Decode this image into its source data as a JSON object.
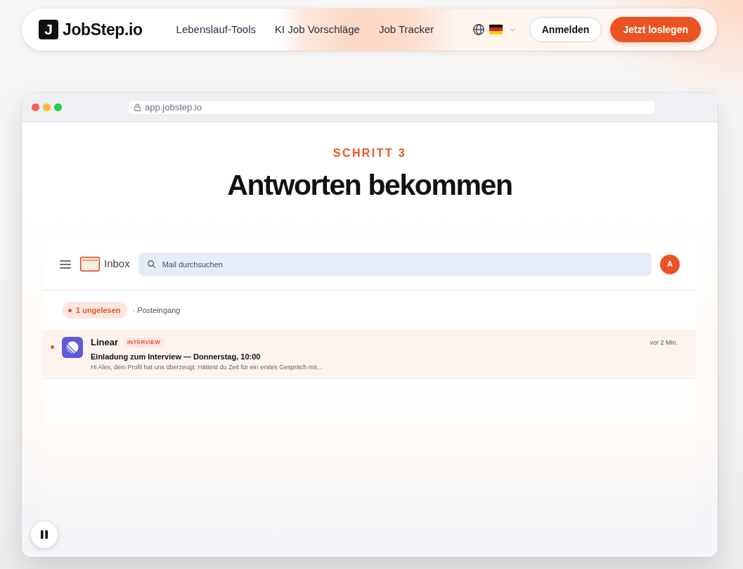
{
  "navbar": {
    "logo_letter": "J",
    "brand": "JobStep.io",
    "links": [
      "Lebenslauf-Tools",
      "KI Job Vorschläge",
      "Job Tracker"
    ],
    "buttons": [
      {
        "label": "Anmelden",
        "kind": "outline"
      },
      {
        "label": "Jetzt loslegen",
        "kind": "primary"
      }
    ]
  },
  "browser": {
    "url": "app.jobstep.io"
  },
  "step": {
    "eyebrow": "SCHRITT 3",
    "title": "Antworten bekommen"
  },
  "mail_app": {
    "title": "Inbox",
    "search": {
      "placeholder": "Mail durchsuchen"
    },
    "avatar": "A",
    "unread_filter": "1 ungelesen",
    "folder": "· Posteingang",
    "messages": [
      {
        "sender": "Linear",
        "tag": "INTERVIEW",
        "subject": "Einladung zum Interview — Donnerstag, 10:00",
        "preview": "Hi Alex, dein Profil hat uns überzeugt. Hättest du Zeit für ein erstes Gespräch mit…",
        "time": "vor 2 Min.",
        "unread": true
      }
    ]
  }
}
